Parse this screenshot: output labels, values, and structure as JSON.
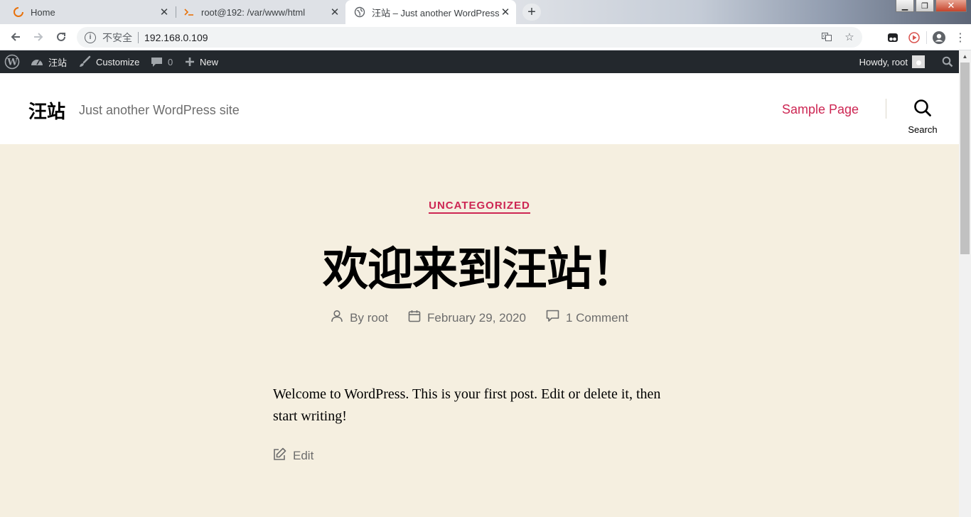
{
  "browser": {
    "tabs": [
      {
        "title": "Home",
        "active": false
      },
      {
        "title": "root@192: /var/www/html",
        "active": false
      },
      {
        "title": "汪站 – Just another WordPress site",
        "active": true
      }
    ],
    "address": {
      "security_label": "不安全",
      "url": "192.168.0.109"
    }
  },
  "adminbar": {
    "site_name": "汪站",
    "customize": "Customize",
    "comments_count": "0",
    "new": "New",
    "howdy": "Howdy, root"
  },
  "site": {
    "title": "汪站",
    "description": "Just another WordPress site",
    "nav": {
      "sample_page": "Sample Page"
    },
    "search_label": "Search"
  },
  "post": {
    "category": "UNCATEGORIZED",
    "title": "欢迎来到汪站！",
    "author": "By root",
    "date": "February 29, 2020",
    "comments": "1 Comment",
    "body": "Welcome to WordPress. This is your first post. Edit or delete it, then start writing!",
    "edit_label": "Edit"
  },
  "colors": {
    "accent": "#cd2653",
    "background": "#f5efe0",
    "adminbar": "#23282d"
  }
}
